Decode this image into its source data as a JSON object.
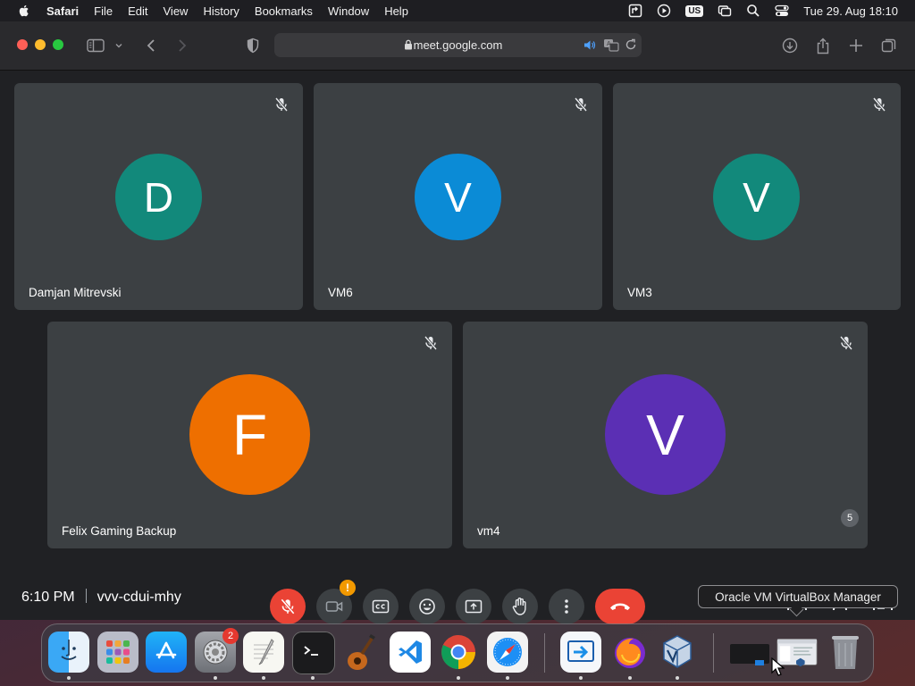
{
  "menubar": {
    "app_name": "Safari",
    "items": [
      "File",
      "Edit",
      "View",
      "History",
      "Bookmarks",
      "Window",
      "Help"
    ],
    "input_source": "US",
    "clock": "Tue 29. Aug  18:10"
  },
  "browser": {
    "url": "meet.google.com"
  },
  "meet": {
    "participants": [
      {
        "name": "Damjan Mitrevski",
        "initial": "D",
        "color": "#12897b"
      },
      {
        "name": "VM6",
        "initial": "V",
        "color": "#0b8bd6"
      },
      {
        "name": "VM3",
        "initial": "V",
        "color": "#12897b"
      },
      {
        "name": "Felix Gaming Backup",
        "initial": "F",
        "color": "#ee6f00"
      },
      {
        "name": "vm4",
        "initial": "V",
        "color": "#5b2fb4"
      }
    ],
    "time": "6:10 PM",
    "meeting_code": "vvv-cdui-mhy",
    "camera_warning": "!",
    "participant_count": "5"
  },
  "tooltip": {
    "text": "Oracle VM VirtualBox Manager"
  },
  "dock": {
    "settings_badge": "2"
  }
}
